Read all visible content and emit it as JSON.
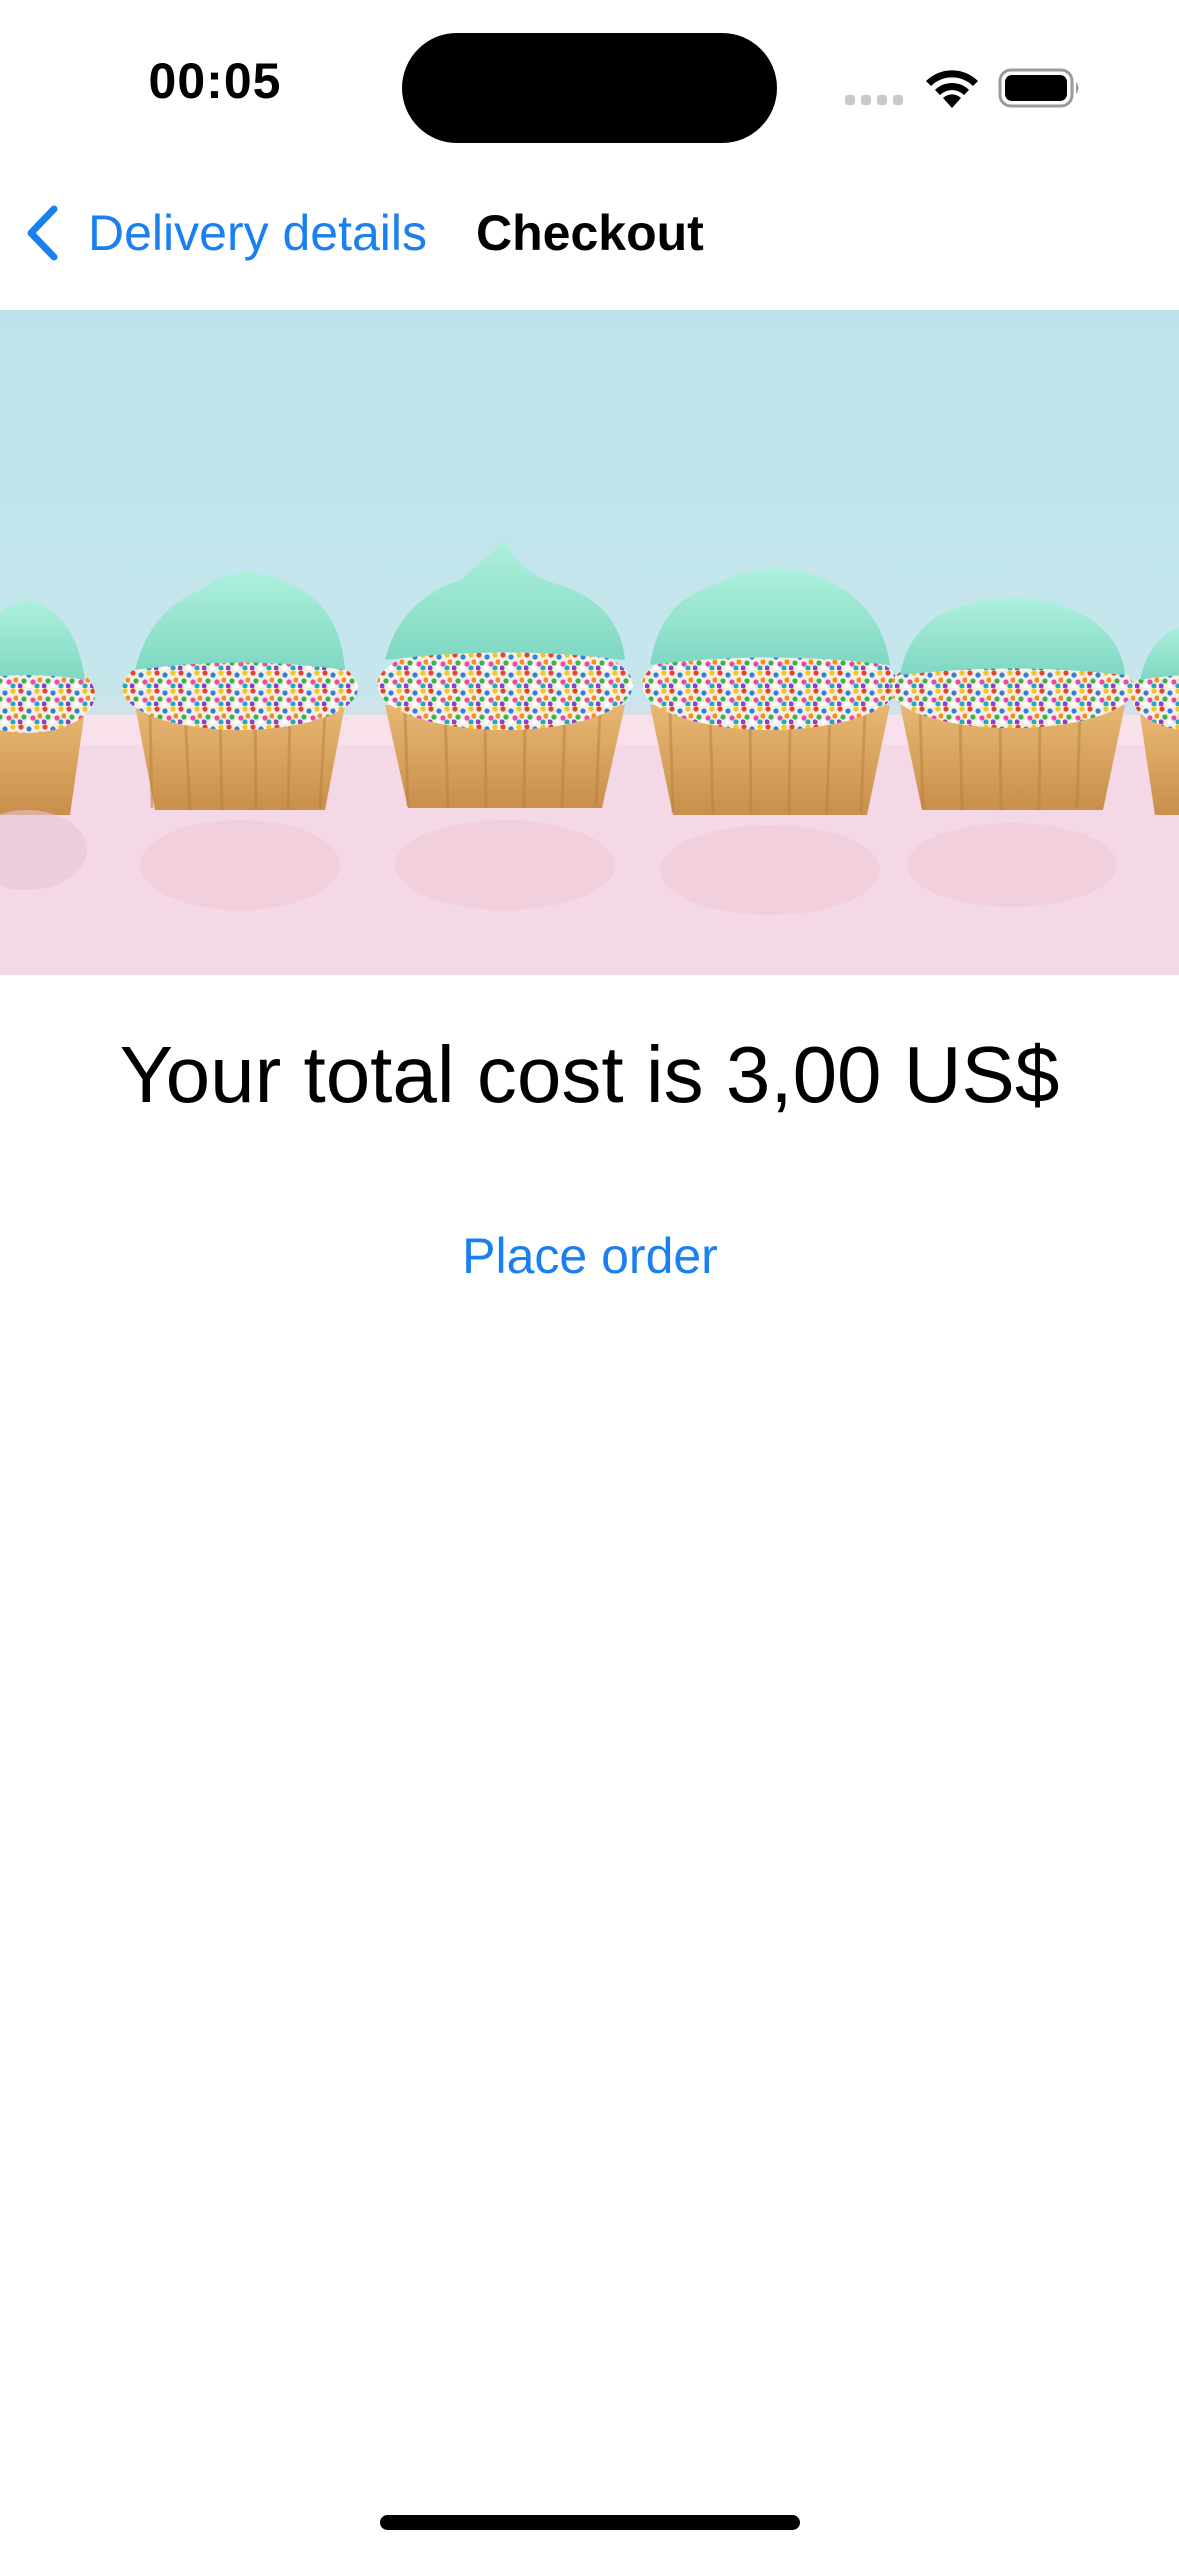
{
  "status_bar": {
    "time": "00:05",
    "signal_icon": "cellular-signal-icon",
    "wifi_icon": "wifi-icon",
    "battery_icon": "battery-full-icon"
  },
  "nav_bar": {
    "back_label": "Delivery details",
    "back_icon": "chevron-left-icon",
    "title": "Checkout"
  },
  "hero": {
    "image": "cupcakes-with-mint-frosting-and-sprinkles"
  },
  "checkout": {
    "total_text": "Your total cost is 3,00 US$",
    "place_order_label": "Place order"
  },
  "colors": {
    "accent": "#1a7ff0",
    "background": "#ffffff",
    "text": "#000000"
  }
}
